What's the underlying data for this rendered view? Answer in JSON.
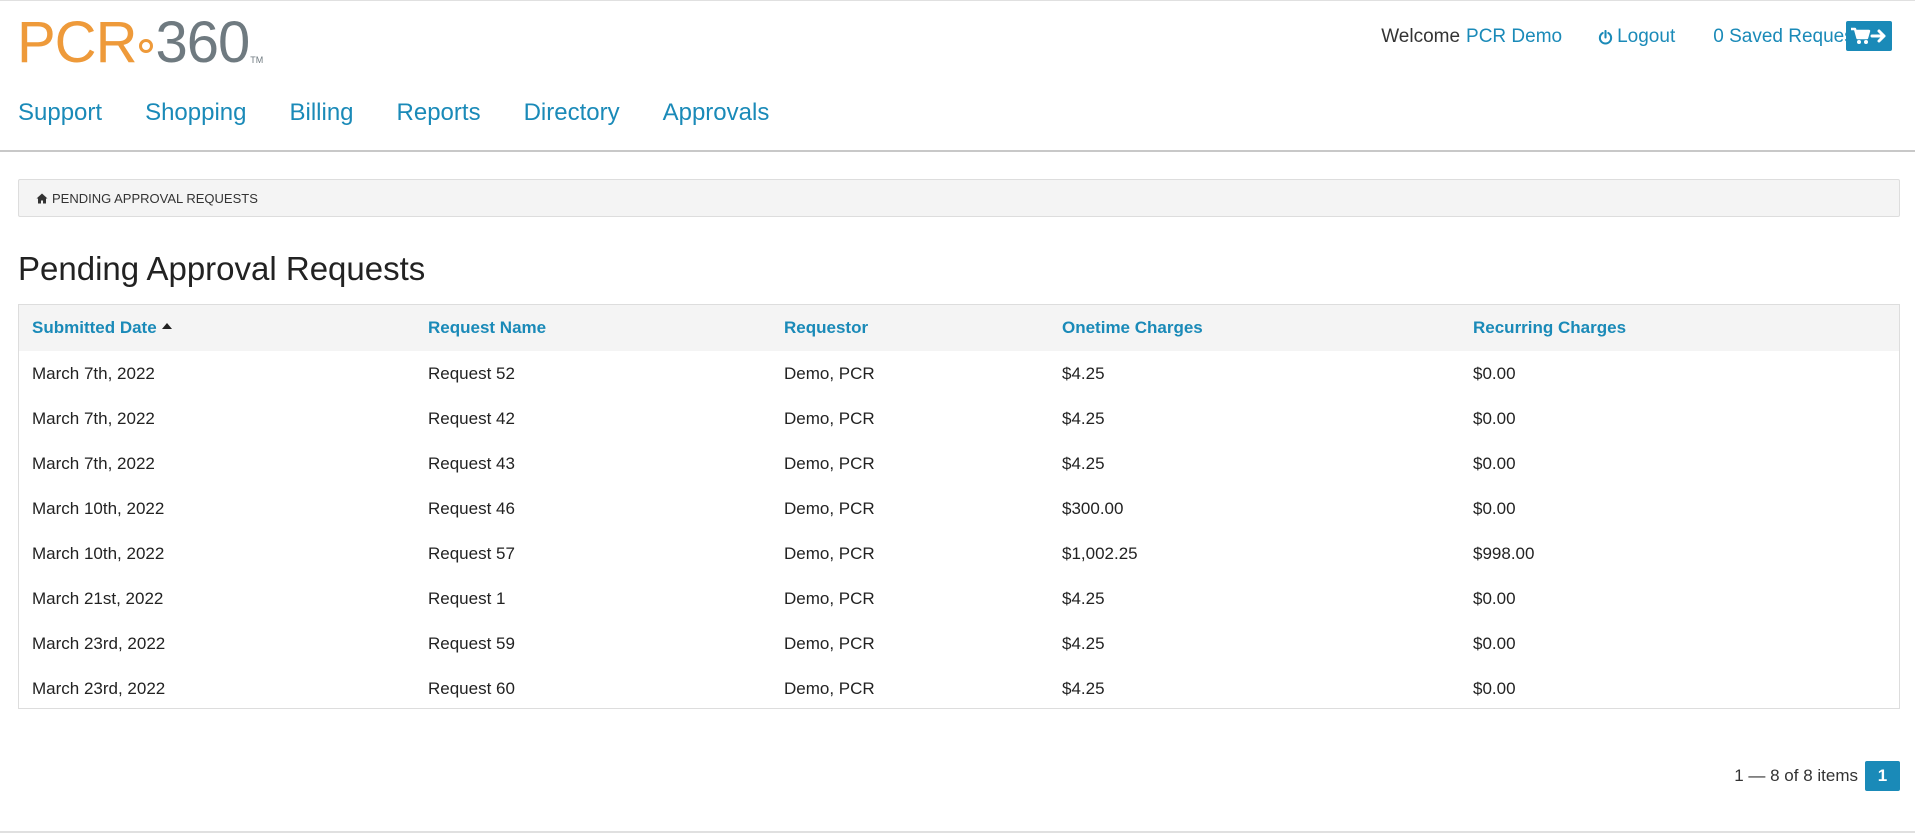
{
  "brand": {
    "logo_text_left": "PCR",
    "logo_text_right": "360",
    "logo_tm": "TM"
  },
  "user_bar": {
    "welcome": "Welcome",
    "username": "PCR Demo",
    "logout": "Logout",
    "saved_request": "0 Saved Request"
  },
  "nav": {
    "items": [
      "Support",
      "Shopping",
      "Billing",
      "Reports",
      "Directory",
      "Approvals"
    ]
  },
  "breadcrumb": {
    "label": "PENDING APPROVAL REQUESTS"
  },
  "page": {
    "title": "Pending Approval Requests"
  },
  "table": {
    "columns": [
      "Submitted Date",
      "Request Name",
      "Requestor",
      "Onetime Charges",
      "Recurring Charges"
    ],
    "sorted_column": "Submitted Date",
    "sort_direction": "ascending",
    "rows": [
      {
        "date": "March 7th, 2022",
        "name": "Request 52",
        "requestor": "Demo, PCR",
        "onetime": "$4.25",
        "recurring": "$0.00"
      },
      {
        "date": "March 7th, 2022",
        "name": "Request 42",
        "requestor": "Demo, PCR",
        "onetime": "$4.25",
        "recurring": "$0.00"
      },
      {
        "date": "March 7th, 2022",
        "name": "Request 43",
        "requestor": "Demo, PCR",
        "onetime": "$4.25",
        "recurring": "$0.00"
      },
      {
        "date": "March 10th, 2022",
        "name": "Request 46",
        "requestor": "Demo, PCR",
        "onetime": "$300.00",
        "recurring": "$0.00"
      },
      {
        "date": "March 10th, 2022",
        "name": "Request 57",
        "requestor": "Demo, PCR",
        "onetime": "$1,002.25",
        "recurring": "$998.00"
      },
      {
        "date": "March 21st, 2022",
        "name": "Request 1",
        "requestor": "Demo, PCR",
        "onetime": "$4.25",
        "recurring": "$0.00"
      },
      {
        "date": "March 23rd, 2022",
        "name": "Request 59",
        "requestor": "Demo, PCR",
        "onetime": "$4.25",
        "recurring": "$0.00"
      },
      {
        "date": "March 23rd, 2022",
        "name": "Request 60",
        "requestor": "Demo, PCR",
        "onetime": "$4.25",
        "recurring": "$0.00"
      }
    ]
  },
  "pagination": {
    "summary": "1 — 8 of 8 items",
    "current_page": "1"
  },
  "colors": {
    "accent": "#1a8ab8",
    "logo_orange": "#ee9a3a",
    "logo_gray": "#6f7a80"
  },
  "icons": {
    "logout": "power-icon",
    "cart": "cart-arrow-icon",
    "breadcrumb": "home-icon",
    "sort": "sort-ascending-icon"
  }
}
